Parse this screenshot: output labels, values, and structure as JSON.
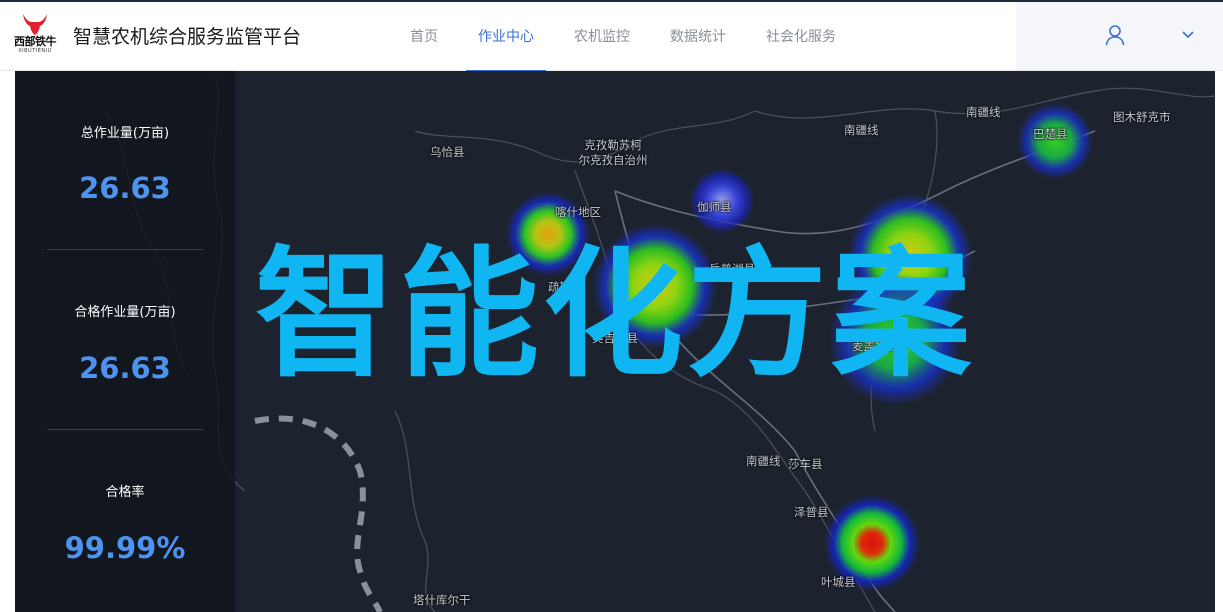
{
  "header": {
    "logo_text": "西部铁牛",
    "logo_subtext": "XIBUTIENIU",
    "app_title": "智慧农机综合服务监管平台",
    "nav": [
      {
        "label": "首页",
        "active": false
      },
      {
        "label": "作业中心",
        "active": true
      },
      {
        "label": "农机监控",
        "active": false
      },
      {
        "label": "数据统计",
        "active": false
      },
      {
        "label": "社会化服务",
        "active": false
      }
    ],
    "user_icon": "user-icon",
    "dropdown_icon": "chevron-down-icon"
  },
  "stats": [
    {
      "label": "总作业量(万亩)",
      "value": "26.63"
    },
    {
      "label": "合格作业量(万亩)",
      "value": "26.63"
    },
    {
      "label": "合格率",
      "value": "99.99%"
    }
  ],
  "map": {
    "labels": [
      "乌恰县",
      "克孜勒苏柯\n尔克孜自治州",
      "喀什地区",
      "伽师县",
      "岳普湖县",
      "疏勒县",
      "英吉沙县",
      "麦盖提县",
      "南疆线",
      "南疆线",
      "图木舒克市",
      "巴楚县",
      "南疆线",
      "莎车县",
      "泽普县",
      "叶城县",
      "塔什库尔干"
    ]
  },
  "overlay": {
    "title": "智能化方案",
    "title_color": "#0fb6f2"
  },
  "colors": {
    "accent": "#3b6fd6",
    "stat_value": "#4d94f0",
    "panel_bg": "#1d232e"
  }
}
